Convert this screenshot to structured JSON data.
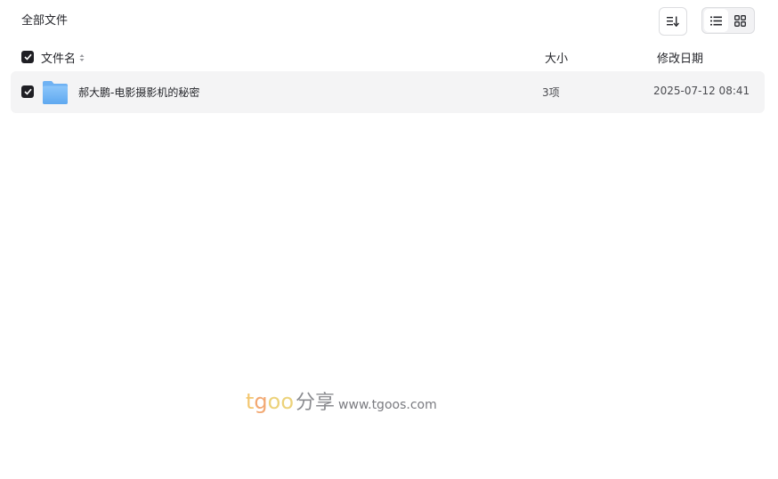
{
  "breadcrumb": {
    "title": "全部文件"
  },
  "toolbar": {
    "sort_icon": "sort-icon",
    "view_list_icon": "list-view-icon",
    "view_grid_icon": "grid-view-icon",
    "active_view": "list"
  },
  "table": {
    "headers": {
      "name": "文件名",
      "size": "大小",
      "date": "修改日期"
    },
    "rows": [
      {
        "name": "郝大鹏-电影摄影机的秘密",
        "size": "3项",
        "date": "2025-07-12 08:41",
        "type": "folder",
        "checked": true
      }
    ]
  },
  "watermark": {
    "brand_t": "t",
    "brand_g": "g",
    "brand_oo": "oo",
    "brand_cn": "分享",
    "url": "www.tgoos.com"
  },
  "colors": {
    "folder": "#7ab8f5",
    "checkbox": "#1f1f24",
    "row_bg": "#f4f4f5"
  }
}
